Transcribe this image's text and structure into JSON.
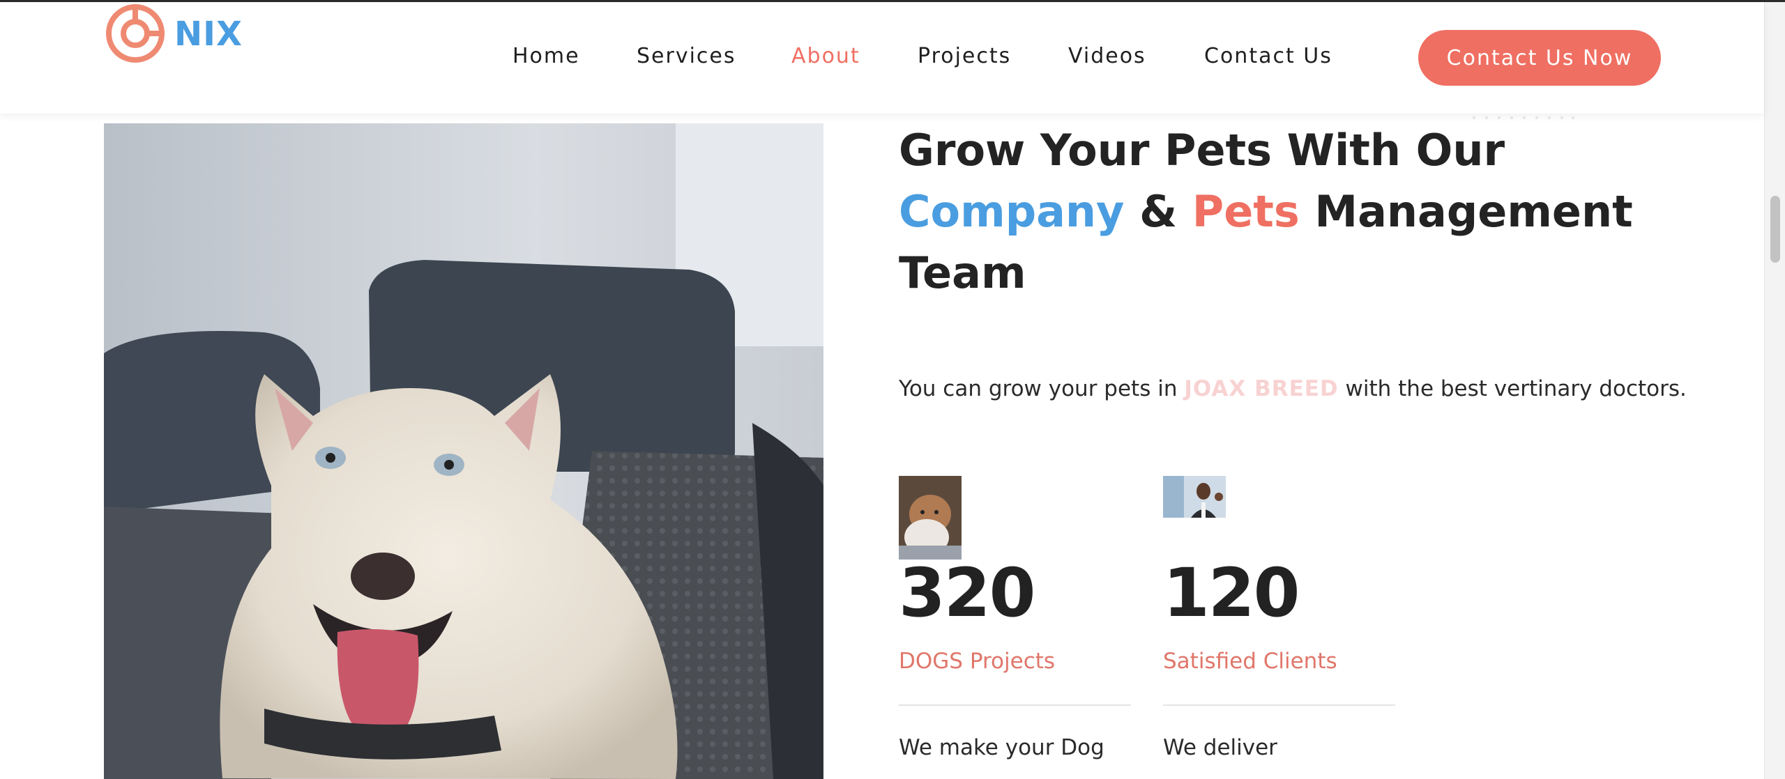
{
  "header": {
    "logo_text": "NIX",
    "nav": [
      {
        "label": "Home",
        "active": false
      },
      {
        "label": "Services",
        "active": false
      },
      {
        "label": "About",
        "active": true
      },
      {
        "label": "Projects",
        "active": false
      },
      {
        "label": "Videos",
        "active": false
      },
      {
        "label": "Contact Us",
        "active": false
      }
    ],
    "cta_label": "Contact Us Now"
  },
  "hero": {
    "photo_alt": "white husky dog in car seat",
    "heading_line1": "Grow Your Pets With Our",
    "heading_company": "Company",
    "heading_amp": "&",
    "heading_pets": "Pets",
    "heading_management": "Management",
    "heading_line3": "Team",
    "subtext_before": "You can grow your pets in",
    "subtext_brand": "JOAX BREED",
    "subtext_after": "with the best vertinary doctors."
  },
  "stats": [
    {
      "number": "320",
      "label": "DOGS Projects",
      "desc": "We make your Dog",
      "thumb_icon": "dogs-thumbnail"
    },
    {
      "number": "120",
      "label": "Satisfied Clients",
      "desc": "We deliver",
      "thumb_icon": "client-thumbnail"
    }
  ],
  "colors": {
    "accent": "#ef6f62",
    "brand_blue": "#4a9de0",
    "text_dark": "#232323",
    "brand_faded": "#f8d2d2"
  }
}
